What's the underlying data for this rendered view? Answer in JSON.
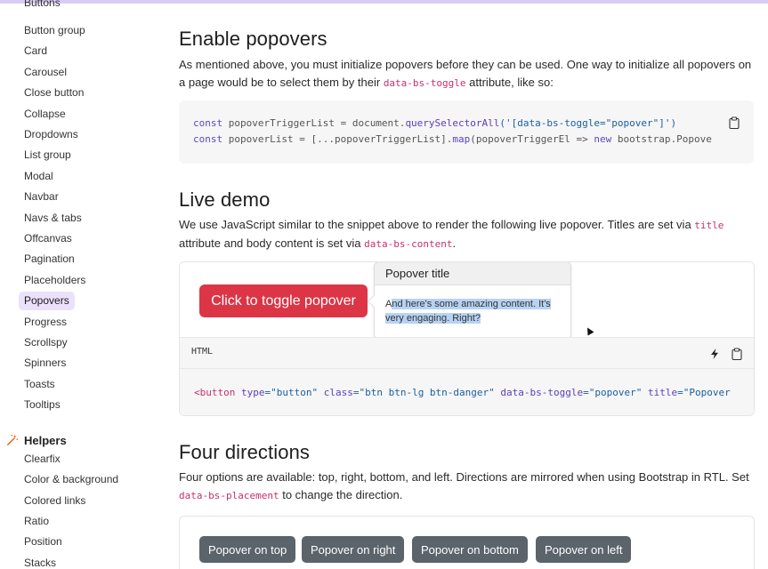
{
  "sidebar": {
    "cut_item": "Buttons",
    "items": [
      {
        "label": "Button group"
      },
      {
        "label": "Card"
      },
      {
        "label": "Carousel"
      },
      {
        "label": "Close button"
      },
      {
        "label": "Collapse"
      },
      {
        "label": "Dropdowns"
      },
      {
        "label": "List group"
      },
      {
        "label": "Modal"
      },
      {
        "label": "Navbar"
      },
      {
        "label": "Navs & tabs"
      },
      {
        "label": "Offcanvas"
      },
      {
        "label": "Pagination"
      },
      {
        "label": "Placeholders"
      },
      {
        "label": "Popovers",
        "active": true
      },
      {
        "label": "Progress"
      },
      {
        "label": "Scrollspy"
      },
      {
        "label": "Spinners"
      },
      {
        "label": "Toasts"
      },
      {
        "label": "Tooltips"
      }
    ],
    "helpers_title": "Helpers",
    "helpers_icon": "magic-wand-icon",
    "helper_items": [
      {
        "label": "Clearfix"
      },
      {
        "label": "Color & background"
      },
      {
        "label": "Colored links"
      },
      {
        "label": "Ratio"
      },
      {
        "label": "Position"
      },
      {
        "label": "Stacks"
      }
    ]
  },
  "sections": {
    "enable": {
      "title": "Enable popovers",
      "text_1": "As mentioned above, you must initialize popovers before they can be used. One way to initialize all popovers on a page would be to select them by their ",
      "code_1": "data-bs-toggle",
      "text_2": " attribute, like so:",
      "code_lines": {
        "l1_kw": "const",
        "l1_var": " popoverTriggerList = document.",
        "l1_fn": "querySelectorAll",
        "l1_str": "('[data-bs-toggle=\"popover\"]')",
        "l2_kw": "const",
        "l2_var": " popoverList = [...popoverTriggerList].",
        "l2_fn": "map",
        "l2_rest": "(popoverTriggerEl => ",
        "l2_new": "new",
        "l2_end": " bootstrap.Popove"
      }
    },
    "live": {
      "title": "Live demo",
      "text_1": "We use JavaScript similar to the snippet above to render the following live popover. Titles are set via ",
      "code_1": "title",
      "text_2": " attribute and body content is set via ",
      "code_2": "data-bs-content",
      "text_3": ".",
      "button_label": "Click to toggle popover",
      "popover_title": "Popover title",
      "popover_body_start": "A",
      "popover_body_selected": "nd here's some amazing content. It's very engaging. Right?",
      "bar_label": "HTML",
      "code": {
        "open": "<button",
        "a1": " type",
        "v1": "=\"button\"",
        "a2": " class",
        "v2": "=\"btn btn-lg btn-danger\"",
        "a3": " data-bs-toggle",
        "v3": "=\"popover\"",
        "a4": " title",
        "v4": "=\"Popover"
      }
    },
    "directions": {
      "title": "Four directions",
      "text_1": "Four options are available: top, right, bottom, and left. Directions are mirrored when using Bootstrap in RTL. Set ",
      "code_1": "data-bs-placement",
      "text_2": " to change the direction.",
      "buttons": [
        "Popover on top",
        "Popover on right",
        "Popover on bottom",
        "Popover on left"
      ]
    }
  },
  "colors": {
    "accent": "#dc3545",
    "secondary": "#5b636b",
    "active_nav": "#ebe1fa",
    "code_pink": "#c6306f"
  }
}
